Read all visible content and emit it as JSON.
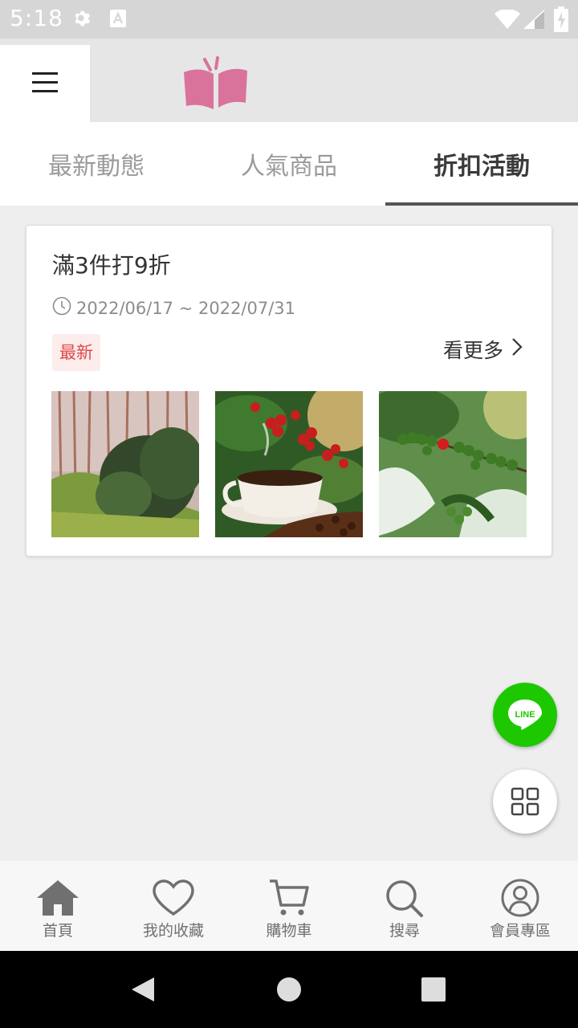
{
  "status_bar": {
    "time": "5:18"
  },
  "tabs": [
    {
      "label": "最新動態",
      "active": false
    },
    {
      "label": "人氣商品",
      "active": false
    },
    {
      "label": "折扣活動",
      "active": true
    }
  ],
  "promo": {
    "title": "滿3件打9折",
    "date_range": "2022/06/17 ~ 2022/07/31",
    "badge": "最新",
    "see_more": "看更多"
  },
  "fab": {
    "line_label": "LINE"
  },
  "bottom_nav": [
    {
      "label": "首頁",
      "icon": "home-icon"
    },
    {
      "label": "我的收藏",
      "icon": "heart-icon"
    },
    {
      "label": "購物車",
      "icon": "cart-icon"
    },
    {
      "label": "搜尋",
      "icon": "search-icon"
    },
    {
      "label": "會員專區",
      "icon": "user-icon"
    }
  ],
  "colors": {
    "logo_pink": "#d9739c",
    "badge_red": "#e04848",
    "line_green": "#1ec800"
  }
}
